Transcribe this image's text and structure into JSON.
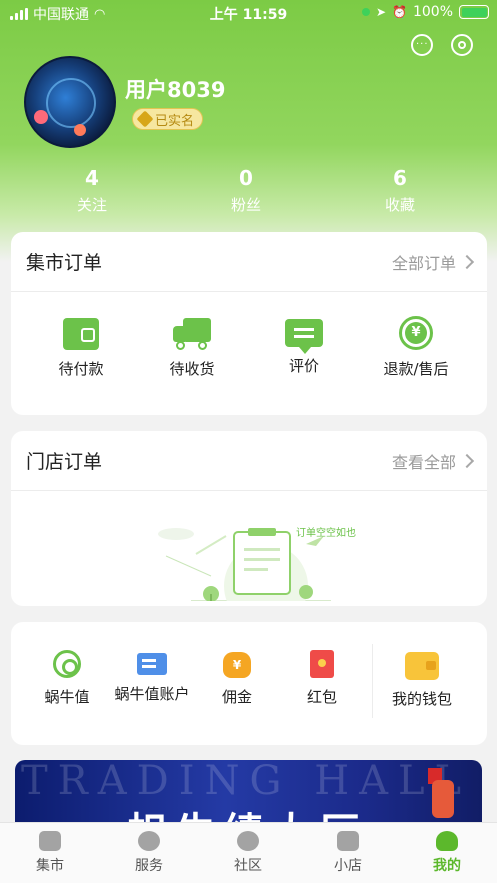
{
  "status_bar": {
    "carrier": "中国联通",
    "time": "上午 11:59",
    "battery": "100%"
  },
  "profile": {
    "username": "用户8039",
    "verified_label": "已实名"
  },
  "stats": [
    {
      "count": "4",
      "label": "关注"
    },
    {
      "count": "0",
      "label": "粉丝"
    },
    {
      "count": "6",
      "label": "收藏"
    }
  ],
  "market_orders": {
    "title": "集市订单",
    "more": "全部订单",
    "items": [
      {
        "label": "待付款",
        "icon": "wallet-icon"
      },
      {
        "label": "待收货",
        "icon": "truck-icon"
      },
      {
        "label": "评价",
        "icon": "comment-icon"
      },
      {
        "label": "退款/售后",
        "icon": "refund-icon"
      }
    ]
  },
  "store_orders": {
    "title": "门店订单",
    "more": "查看全部",
    "empty_text": "订单空空如也"
  },
  "assets": [
    {
      "label": "蜗牛值",
      "icon": "snail-icon"
    },
    {
      "label": "蜗牛值账户",
      "icon": "card-icon"
    },
    {
      "label": "佣金",
      "icon": "money-bag-icon"
    },
    {
      "label": "红包",
      "icon": "red-packet-icon"
    },
    {
      "label": "我的钱包",
      "icon": "wallet-icon"
    }
  ],
  "banner": {
    "bg_text": "TRADING HALL",
    "title": "帜牛绩大厅"
  },
  "tabbar": [
    {
      "label": "集市",
      "active": false
    },
    {
      "label": "服务",
      "active": false
    },
    {
      "label": "社区",
      "active": false
    },
    {
      "label": "小店",
      "active": false
    },
    {
      "label": "我的",
      "active": true
    }
  ],
  "colors": {
    "brand_green": "#6cc24a",
    "active_tab": "#5cb82c",
    "badge_gold": "#d7a619"
  }
}
